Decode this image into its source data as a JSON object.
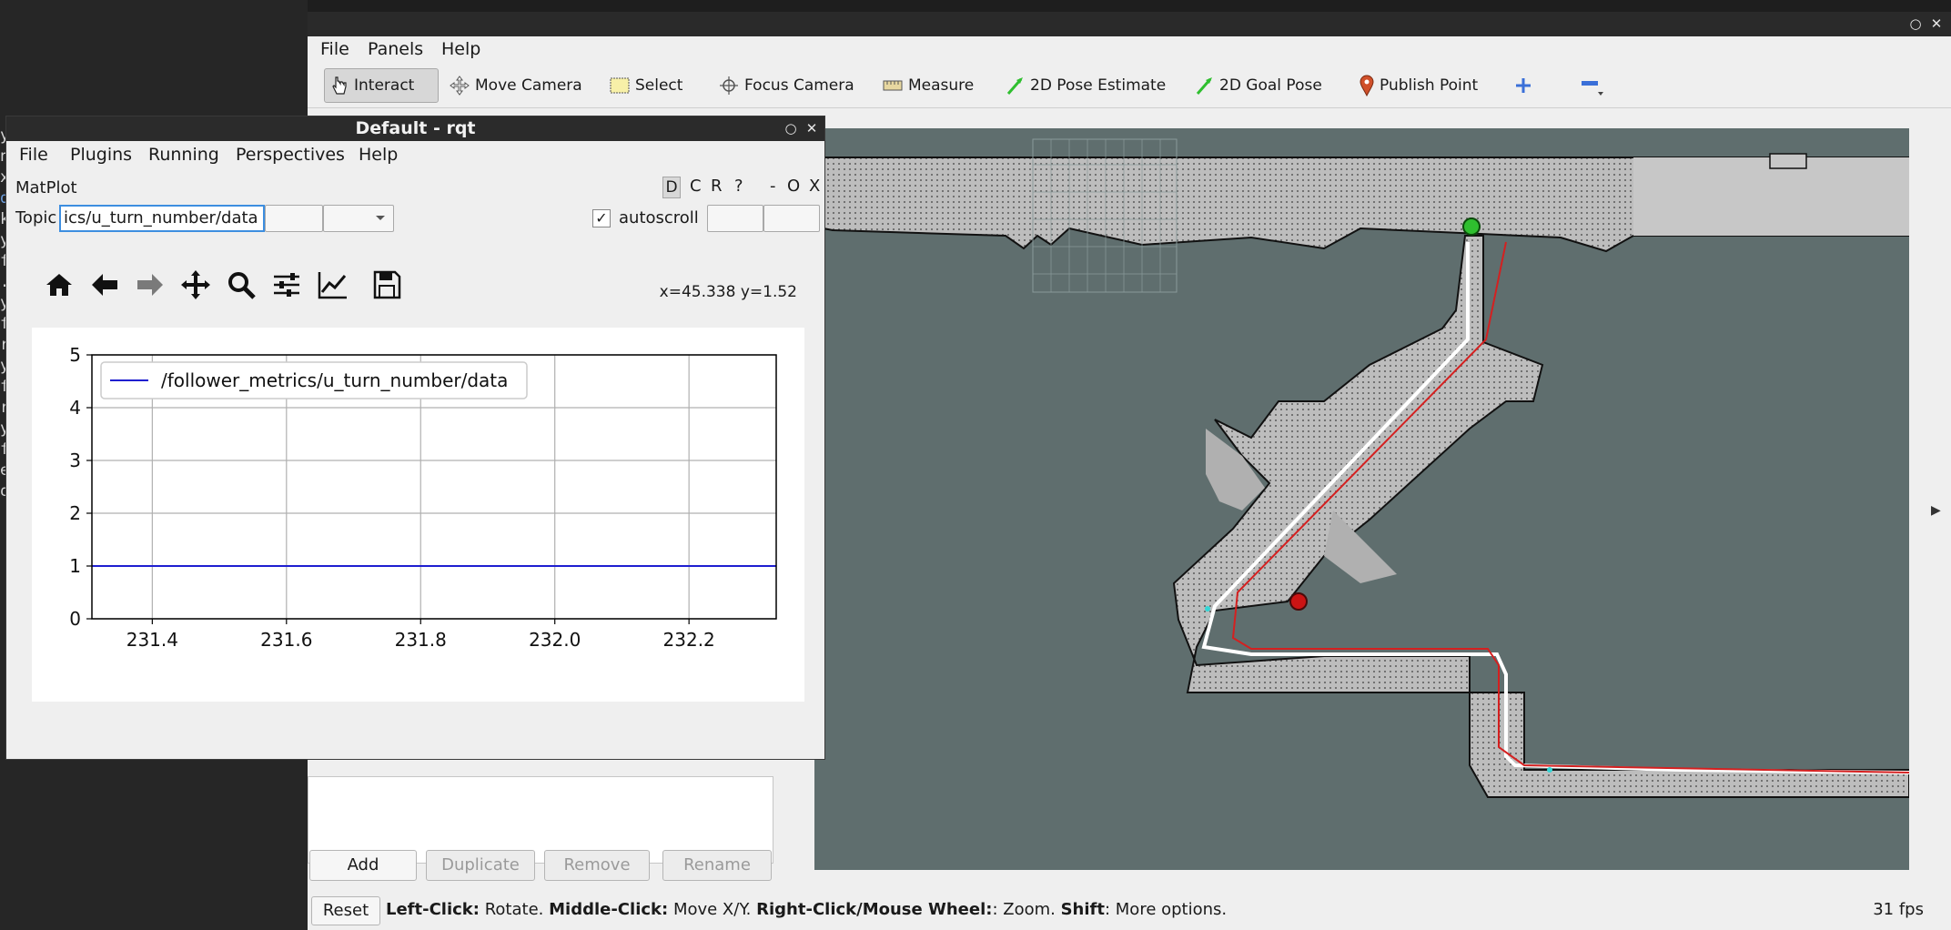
{
  "terminal": {
    "chars": [
      "y",
      "n",
      "x",
      "d",
      "k",
      "y",
      "f",
      ".",
      "y",
      "f",
      "r",
      "y",
      "f",
      "r",
      "y",
      "f",
      "e",
      "o"
    ]
  },
  "rviz": {
    "menu": {
      "file": "File",
      "panels": "Panels",
      "help": "Help"
    },
    "toolbar": {
      "interact": "Interact",
      "move_camera": "Move Camera",
      "select": "Select",
      "focus_camera": "Focus Camera",
      "measure": "Measure",
      "pose_estimate": "2D Pose Estimate",
      "goal_pose": "2D Goal Pose",
      "publish_point": "Publish Point"
    },
    "panel_buttons": {
      "add": "Add",
      "duplicate": "Duplicate",
      "remove": "Remove",
      "rename": "Rename"
    },
    "status": {
      "reset": "Reset",
      "left_click_key": "Left-Click:",
      "left_click_val": "Rotate.",
      "middle_click_key": "Middle-Click:",
      "middle_click_val": "Move X/Y.",
      "right_click_key": "Right-Click/Mouse Wheel:",
      "right_click_val": ": Zoom.",
      "shift_key": "Shift",
      "shift_val": ": More options.",
      "fps": "31 fps"
    },
    "colors": {
      "map_bg": "#5f6e6e",
      "path_red": "#d42020",
      "path_white": "#ffffff",
      "goal_green": "#2fbf2f",
      "robot_red": "#cc1414"
    }
  },
  "rqt": {
    "title": "Default - rqt",
    "menu": {
      "file": "File",
      "plugins": "Plugins",
      "running": "Running",
      "perspectives": "Perspectives",
      "help": "Help"
    },
    "plugin_title": "MatPlot",
    "plugin_buttons": {
      "d": "D",
      "c": "C",
      "r": "R",
      "q": "?",
      "minus": "-",
      "o": "O",
      "x": "X"
    },
    "topic_label": "Topic",
    "topic_value": "ics/u_turn_number/data",
    "autoscroll_label": "autoscroll",
    "autoscroll_checked": true,
    "coord_readout": "x=45.338 y=1.52"
  },
  "chart_data": {
    "type": "line",
    "title": "",
    "xlabel": "",
    "ylabel": "",
    "xlim": [
      231.31,
      232.33
    ],
    "ylim": [
      0,
      5
    ],
    "xticks": [
      "231.4",
      "231.6",
      "231.8",
      "232.0",
      "232.2"
    ],
    "xtick_values": [
      231.4,
      231.6,
      231.8,
      232.0,
      232.2
    ],
    "yticks": [
      "0",
      "1",
      "2",
      "3",
      "4",
      "5"
    ],
    "ytick_values": [
      0,
      1,
      2,
      3,
      4,
      5
    ],
    "grid": true,
    "legend_position": "top-left",
    "series": [
      {
        "name": "/follower_metrics/u_turn_number/data",
        "color": "#1f1fd0",
        "x": [
          231.31,
          232.33
        ],
        "y": [
          1,
          1
        ]
      }
    ]
  }
}
